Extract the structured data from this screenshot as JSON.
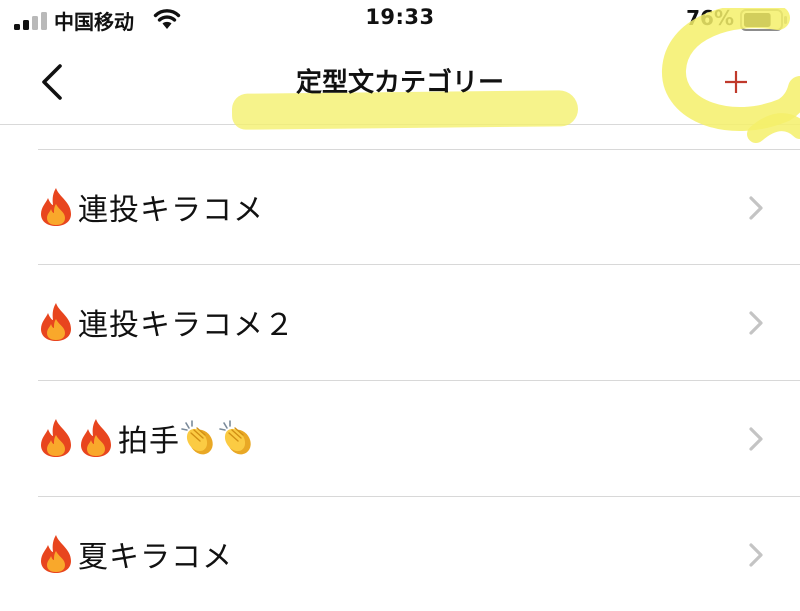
{
  "status_bar": {
    "carrier": "中国移动",
    "time": "19:33",
    "battery_percent": "76%",
    "signal_bars_active": 2,
    "signal_bars_total": 4,
    "battery_level": 0.76
  },
  "nav": {
    "title": "定型文カテゴリー",
    "back_icon": "chevron-left-icon",
    "add_icon": "plus-icon",
    "add_color": "#c0392b"
  },
  "annotations": {
    "highlight_color": "#f4f06a"
  },
  "categories": [
    {
      "label": "連投キラコメ",
      "prefix_icons": [
        "flame-icon"
      ],
      "suffix_icons": []
    },
    {
      "label": "連投キラコメ２",
      "prefix_icons": [
        "flame-icon"
      ],
      "suffix_icons": []
    },
    {
      "label": "拍手",
      "prefix_icons": [
        "flame-icon",
        "flame-icon"
      ],
      "suffix_icons": [
        "clapping-hands-icon",
        "clapping-hands-icon"
      ]
    },
    {
      "label": "夏キラコメ",
      "prefix_icons": [
        "flame-icon"
      ],
      "suffix_icons": []
    }
  ]
}
